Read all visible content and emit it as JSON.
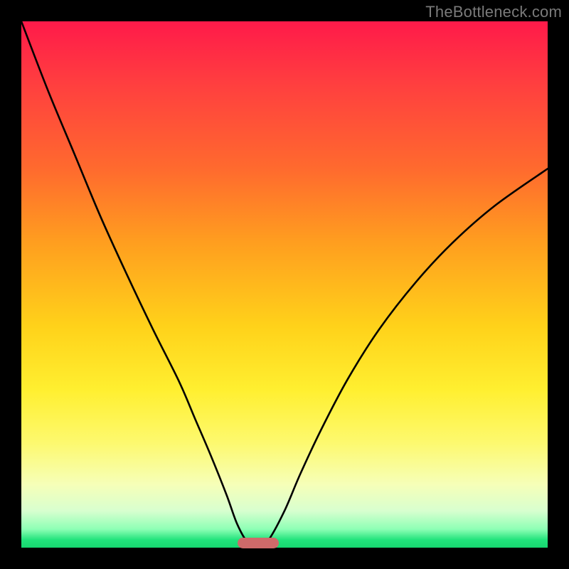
{
  "watermark": "TheBottleneck.com",
  "chart_data": {
    "type": "line",
    "title": "",
    "xlabel": "",
    "ylabel": "",
    "xlim": [
      0,
      100
    ],
    "ylim": [
      0,
      100
    ],
    "x": [
      0,
      5,
      10,
      15,
      20,
      25,
      30,
      33,
      36,
      39,
      41,
      43,
      45,
      47,
      50,
      53,
      57,
      62,
      68,
      75,
      82,
      90,
      100
    ],
    "values": [
      100,
      87,
      75,
      63,
      52,
      41.5,
      31.5,
      24.5,
      17.5,
      10,
      4.5,
      1,
      0,
      1.5,
      7,
      14,
      22.5,
      32,
      41.5,
      50.5,
      58,
      65,
      72
    ],
    "grid": false,
    "legend": false,
    "annotations": [
      {
        "kind": "marker",
        "x": 45,
        "y": 0,
        "shape": "rounded-bar",
        "color": "#cf6a6a"
      }
    ],
    "background_gradient_stops": [
      {
        "pos": 0.0,
        "color": "#ff1a4a"
      },
      {
        "pos": 0.12,
        "color": "#ff3f3f"
      },
      {
        "pos": 0.28,
        "color": "#ff6a2e"
      },
      {
        "pos": 0.42,
        "color": "#ff9e1f"
      },
      {
        "pos": 0.58,
        "color": "#ffd21a"
      },
      {
        "pos": 0.7,
        "color": "#ffef30"
      },
      {
        "pos": 0.8,
        "color": "#fdf96e"
      },
      {
        "pos": 0.88,
        "color": "#f6ffb8"
      },
      {
        "pos": 0.93,
        "color": "#d8ffcf"
      },
      {
        "pos": 0.965,
        "color": "#8dffb5"
      },
      {
        "pos": 0.985,
        "color": "#22e37c"
      },
      {
        "pos": 1.0,
        "color": "#16d66f"
      }
    ]
  }
}
